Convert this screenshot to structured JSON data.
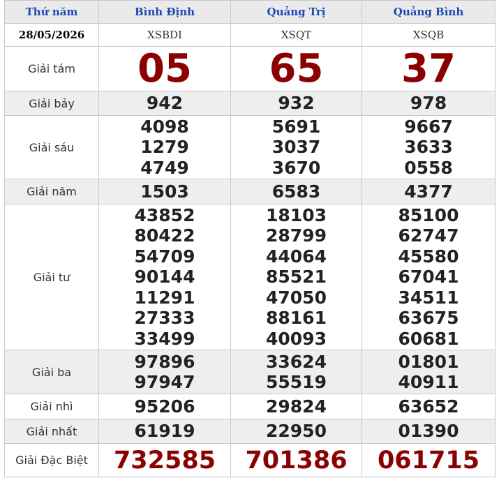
{
  "header": {
    "day_label": "Thứ năm",
    "provinces": [
      "Bình Định",
      "Quảng Trị",
      "Quảng Bình"
    ]
  },
  "subheader": {
    "date": "28/05/2026",
    "codes": [
      "XSBDI",
      "XSQT",
      "XSQB"
    ]
  },
  "prizes": [
    {
      "label": "Giải tám",
      "values": [
        [
          "05"
        ],
        [
          "65"
        ],
        [
          "37"
        ]
      ]
    },
    {
      "label": "Giải bảy",
      "values": [
        [
          "942"
        ],
        [
          "932"
        ],
        [
          "978"
        ]
      ]
    },
    {
      "label": "Giải sáu",
      "values": [
        [
          "4098",
          "1279",
          "4749"
        ],
        [
          "5691",
          "3037",
          "3670"
        ],
        [
          "9667",
          "3633",
          "0558"
        ]
      ]
    },
    {
      "label": "Giải năm",
      "values": [
        [
          "1503"
        ],
        [
          "6583"
        ],
        [
          "4377"
        ]
      ]
    },
    {
      "label": "Giải tư",
      "values": [
        [
          "43852",
          "80422",
          "54709",
          "90144",
          "11291",
          "27333",
          "33499"
        ],
        [
          "18103",
          "28799",
          "44064",
          "85521",
          "47050",
          "88161",
          "40093"
        ],
        [
          "85100",
          "62747",
          "45580",
          "67041",
          "34511",
          "63675",
          "60681"
        ]
      ]
    },
    {
      "label": "Giải ba",
      "values": [
        [
          "97896",
          "97947"
        ],
        [
          "33624",
          "55519"
        ],
        [
          "01801",
          "40911"
        ]
      ]
    },
    {
      "label": "Giải nhì",
      "values": [
        [
          "95206"
        ],
        [
          "29824"
        ],
        [
          "63652"
        ]
      ]
    },
    {
      "label": "Giải nhất",
      "values": [
        [
          "61919"
        ],
        [
          "22950"
        ],
        [
          "01390"
        ]
      ]
    },
    {
      "label": "Giải Đặc Biệt",
      "values": [
        [
          "732585"
        ],
        [
          "701386"
        ],
        [
          "061715"
        ]
      ]
    }
  ],
  "colors": {
    "header_text": "#1c47b8",
    "highlight": "#8b0000",
    "alt_row": "#eeeeee"
  }
}
